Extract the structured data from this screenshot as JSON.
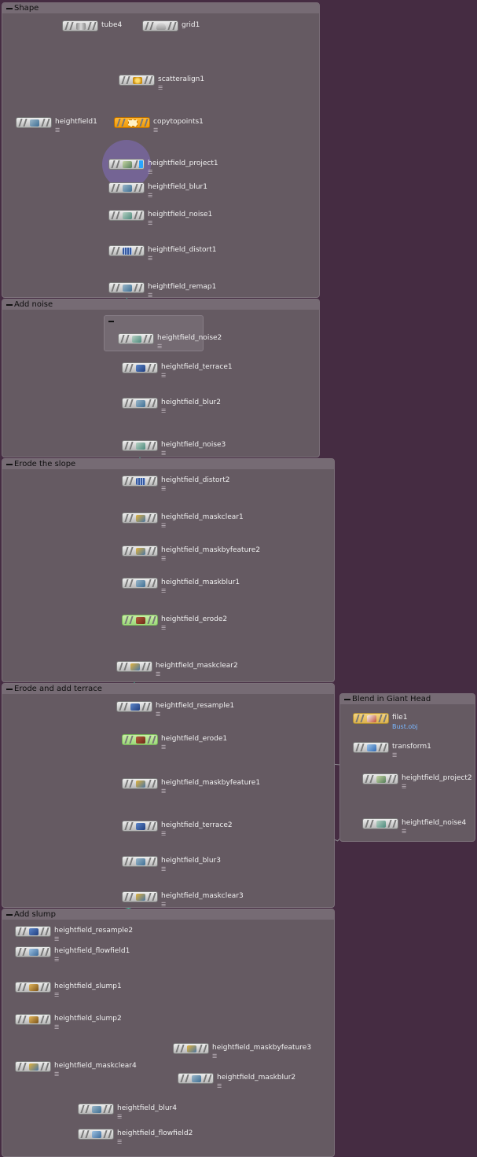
{
  "colors": {
    "background": "#452c42",
    "box": "#655a62",
    "box_title": "#766b74",
    "node_body": "#d8d8d8",
    "node_orange": "#f5a310",
    "node_green": "#a9e286",
    "wire": "#8f8d93",
    "connector": "#2fbf93"
  },
  "boxes": {
    "shape": "Shape",
    "add_noise": "Add noise",
    "erode_slope": "Erode the slope",
    "erode_terrace": "Erode and add terrace",
    "giant_head": "Blend in Giant Head",
    "add_slump": "Add slump"
  },
  "nodes": {
    "tube4": {
      "label": "tube4",
      "icon": "tube-icon"
    },
    "grid1": {
      "label": "grid1",
      "icon": "grid-icon"
    },
    "scatteralign1": {
      "label": "scatteralign1",
      "icon": "scatter-icon"
    },
    "heightfield1": {
      "label": "heightfield1",
      "icon": "heightfield-icon"
    },
    "copytopoints1": {
      "label": "copytopoints1",
      "icon": "copy-icon"
    },
    "project1": {
      "label": "heightfield_project1",
      "icon": "heightfield-project-icon"
    },
    "blur1": {
      "label": "heightfield_blur1",
      "icon": "heightfield-blur-icon"
    },
    "noise1": {
      "label": "heightfield_noise1",
      "icon": "heightfield-noise-icon"
    },
    "distort1": {
      "label": "heightfield_distort1",
      "icon": "heightfield-distort-icon"
    },
    "remap1": {
      "label": "heightfield_remap1",
      "icon": "heightfield-remap-icon"
    },
    "noise2": {
      "label": "heightfield_noise2",
      "icon": "heightfield-noise-icon"
    },
    "terrace1": {
      "label": "heightfield_terrace1",
      "icon": "heightfield-terrace-icon"
    },
    "blur2": {
      "label": "heightfield_blur2",
      "icon": "heightfield-blur-icon"
    },
    "noise3": {
      "label": "heightfield_noise3",
      "icon": "heightfield-noise-icon"
    },
    "distort2": {
      "label": "heightfield_distort2",
      "icon": "heightfield-distort-icon"
    },
    "maskclear1": {
      "label": "heightfield_maskclear1",
      "icon": "heightfield-mask-icon"
    },
    "maskbyfeature2": {
      "label": "heightfield_maskbyfeature2",
      "icon": "heightfield-mask-icon"
    },
    "maskblur1": {
      "label": "heightfield_maskblur1",
      "icon": "heightfield-blur-icon"
    },
    "erode2": {
      "label": "heightfield_erode2",
      "icon": "heightfield-erode-icon"
    },
    "maskclear2": {
      "label": "heightfield_maskclear2",
      "icon": "heightfield-mask-icon"
    },
    "resample1": {
      "label": "heightfield_resample1",
      "icon": "heightfield-resample-icon"
    },
    "erode1": {
      "label": "heightfield_erode1",
      "icon": "heightfield-erode-icon"
    },
    "maskbyfeature1": {
      "label": "heightfield_maskbyfeature1",
      "icon": "heightfield-mask-icon"
    },
    "terrace2": {
      "label": "heightfield_terrace2",
      "icon": "heightfield-terrace-icon"
    },
    "blur3": {
      "label": "heightfield_blur3",
      "icon": "heightfield-blur-icon"
    },
    "maskclear3": {
      "label": "heightfield_maskclear3",
      "icon": "heightfield-mask-icon"
    },
    "file1": {
      "label": "file1",
      "file": "Bust.obj",
      "icon": "file-icon"
    },
    "transform1": {
      "label": "transform1",
      "icon": "transform-icon"
    },
    "project2": {
      "label": "heightfield_project2",
      "icon": "heightfield-project-icon"
    },
    "noise4": {
      "label": "heightfield_noise4",
      "icon": "heightfield-noise-icon"
    },
    "resample2": {
      "label": "heightfield_resample2",
      "icon": "heightfield-resample-icon"
    },
    "flowfield1": {
      "label": "heightfield_flowfield1",
      "icon": "heightfield-flowfield-icon"
    },
    "slump1": {
      "label": "heightfield_slump1",
      "icon": "heightfield-slump-icon"
    },
    "slump2": {
      "label": "heightfield_slump2",
      "icon": "heightfield-slump-icon"
    },
    "maskbyfeature3": {
      "label": "heightfield_maskbyfeature3",
      "icon": "heightfield-mask-icon"
    },
    "maskclear4": {
      "label": "heightfield_maskclear4",
      "icon": "heightfield-mask-icon"
    },
    "maskblur2": {
      "label": "heightfield_maskblur2",
      "icon": "heightfield-blur-icon"
    },
    "blur4": {
      "label": "heightfield_blur4",
      "icon": "heightfield-blur-icon"
    },
    "flowfield2": {
      "label": "heightfield_flowfield2",
      "icon": "heightfield-flowfield-icon"
    }
  }
}
